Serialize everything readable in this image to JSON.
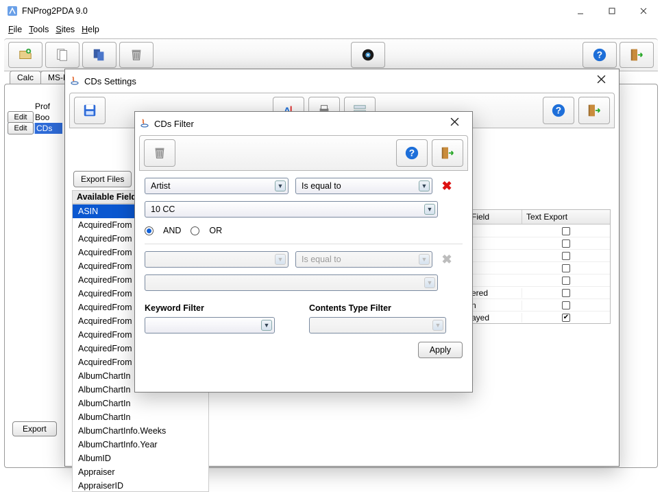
{
  "app": {
    "title": "FNProg2PDA 9.0"
  },
  "menus": {
    "file": "File",
    "tools": "Tools",
    "sites": "Sites",
    "help": "Help"
  },
  "tabs": {
    "calc": "Calc",
    "mse": "MS-E"
  },
  "left_rows": {
    "prof": "Prof",
    "edit1": "Edit",
    "boo": "Boo",
    "edit2": "Edit",
    "cds": "CDs"
  },
  "buttons": {
    "export": "Export",
    "export_files": "Export Files",
    "apply": "Apply"
  },
  "settings": {
    "title": "CDs Settings",
    "available_header": "Available Fields",
    "fields": [
      "ASIN",
      "AcquiredFrom",
      "AcquiredFrom",
      "AcquiredFrom",
      "AcquiredFrom",
      "AcquiredFrom",
      "AcquiredFrom",
      "AcquiredFrom",
      "AcquiredFrom",
      "AcquiredFrom",
      "AcquiredFrom",
      "AcquiredFrom",
      "AlbumChartIn",
      "AlbumChartIn",
      "AlbumChartIn",
      "AlbumChartIn",
      "AlbumChartInfo.Weeks",
      "AlbumChartInfo.Year",
      "AlbumID",
      "Appraiser",
      "AppraiserID"
    ],
    "field_selected_index": 0,
    "right_table": {
      "head_field": "Field",
      "head_text_export": "Text Export",
      "rows": [
        {
          "name": "",
          "checked": false
        },
        {
          "name": "",
          "checked": false
        },
        {
          "name": "",
          "checked": false
        },
        {
          "name": "",
          "checked": false
        },
        {
          "name": "",
          "checked": false
        },
        {
          "name": "ered",
          "checked": false
        },
        {
          "name": "n",
          "checked": false
        },
        {
          "name": "ayed",
          "checked": true
        }
      ]
    }
  },
  "filter": {
    "title": "CDs Filter",
    "row1_field": "Artist",
    "row1_op": "Is equal to",
    "row1_value": "10 CC",
    "logic_and": "AND",
    "logic_or": "OR",
    "logic_selected": "AND",
    "row2_field": "",
    "row2_op": "Is equal to",
    "row2_value": "",
    "keyword_label": "Keyword Filter",
    "contents_label": "Contents Type Filter",
    "keyword_value": "",
    "contents_value": ""
  }
}
